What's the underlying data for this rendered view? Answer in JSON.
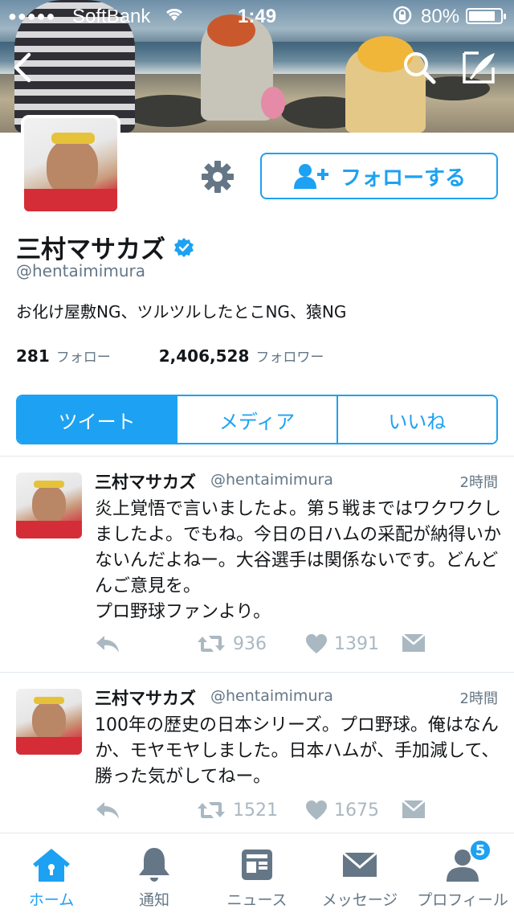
{
  "status_bar": {
    "signal": "●●●●●",
    "carrier": "SoftBank",
    "time": "1:49",
    "battery": "80%"
  },
  "profile": {
    "name": "三村マサカズ",
    "handle": "@hentaimimura",
    "bio": "お化け屋敷NG、ツルツルしたとこNG、猿NG",
    "following_count": "281",
    "following_label": "フォロー",
    "followers_count": "2,406,528",
    "followers_label": "フォロワー",
    "follow_button": "フォローする"
  },
  "tabs": [
    {
      "label": "ツイート",
      "active": true
    },
    {
      "label": "メディア",
      "active": false
    },
    {
      "label": "いいね",
      "active": false
    }
  ],
  "tweets": [
    {
      "name": "三村マサカズ",
      "handle": "@hentaimimura",
      "time": "2時間",
      "text": "炎上覚悟で言いましたよ。第５戦まではワクワクしましたよ。でもね。今日の日ハムの采配が納得いかないんだよねー。大谷選手は関係ないです。どんどんご意見を。",
      "text2": "プロ野球ファンより。",
      "retweets": "936",
      "likes": "1391"
    },
    {
      "name": "三村マサカズ",
      "handle": "@hentaimimura",
      "time": "2時間",
      "text": "100年の歴史の日本シリーズ。プロ野球。俺はなんか、モヤモヤしました。日本ハムが、手加減して、勝った気がしてねー。",
      "retweets": "1521",
      "likes": "1675"
    }
  ],
  "tab_bar": {
    "items": [
      {
        "label": "ホーム",
        "icon": "home-icon",
        "active": true
      },
      {
        "label": "通知",
        "icon": "bell-icon",
        "active": false
      },
      {
        "label": "ニュース",
        "icon": "news-icon",
        "active": false
      },
      {
        "label": "メッセージ",
        "icon": "envelope-icon",
        "active": false
      },
      {
        "label": "プロフィール",
        "icon": "person-icon",
        "active": false
      }
    ],
    "profile_badge": "5"
  },
  "colors": {
    "accent": "#1da1f2",
    "muted": "#657786",
    "action_gray": "#aab8c2"
  }
}
